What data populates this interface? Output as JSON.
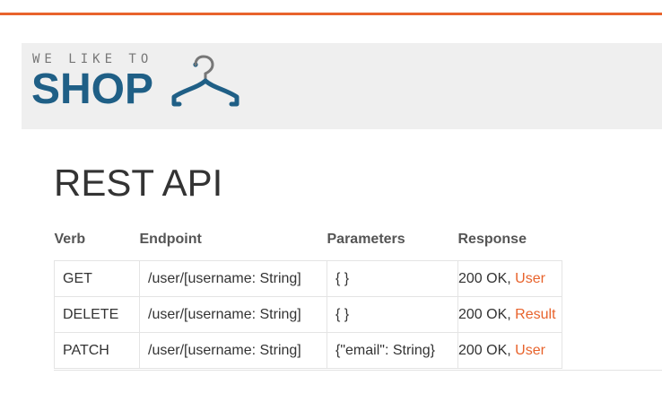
{
  "logo": {
    "tagline": "WE LIKE TO",
    "wordmark": "SHOP",
    "icon": "hanger-icon",
    "colors": {
      "word": "#1f5f86",
      "tag": "#777777"
    }
  },
  "page": {
    "title": "REST API"
  },
  "colors": {
    "accent": "#e8632c",
    "banner_bg": "#efefef"
  },
  "table": {
    "headers": {
      "verb": "Verb",
      "endpoint": "Endpoint",
      "parameters": "Parameters",
      "response": "Response"
    },
    "rows": [
      {
        "verb": "GET",
        "endpoint": "/user/[username: String]",
        "parameters": "{ }",
        "response_status": "200 OK, ",
        "response_type": "User"
      },
      {
        "verb": "DELETE",
        "endpoint": "/user/[username: String]",
        "parameters": "{ }",
        "response_status": "200 OK, ",
        "response_type": "Result"
      },
      {
        "verb": "PATCH",
        "endpoint": "/user/[username: String]",
        "parameters": "{\"email\": String}",
        "response_status": "200 OK, ",
        "response_type": "User"
      }
    ]
  }
}
